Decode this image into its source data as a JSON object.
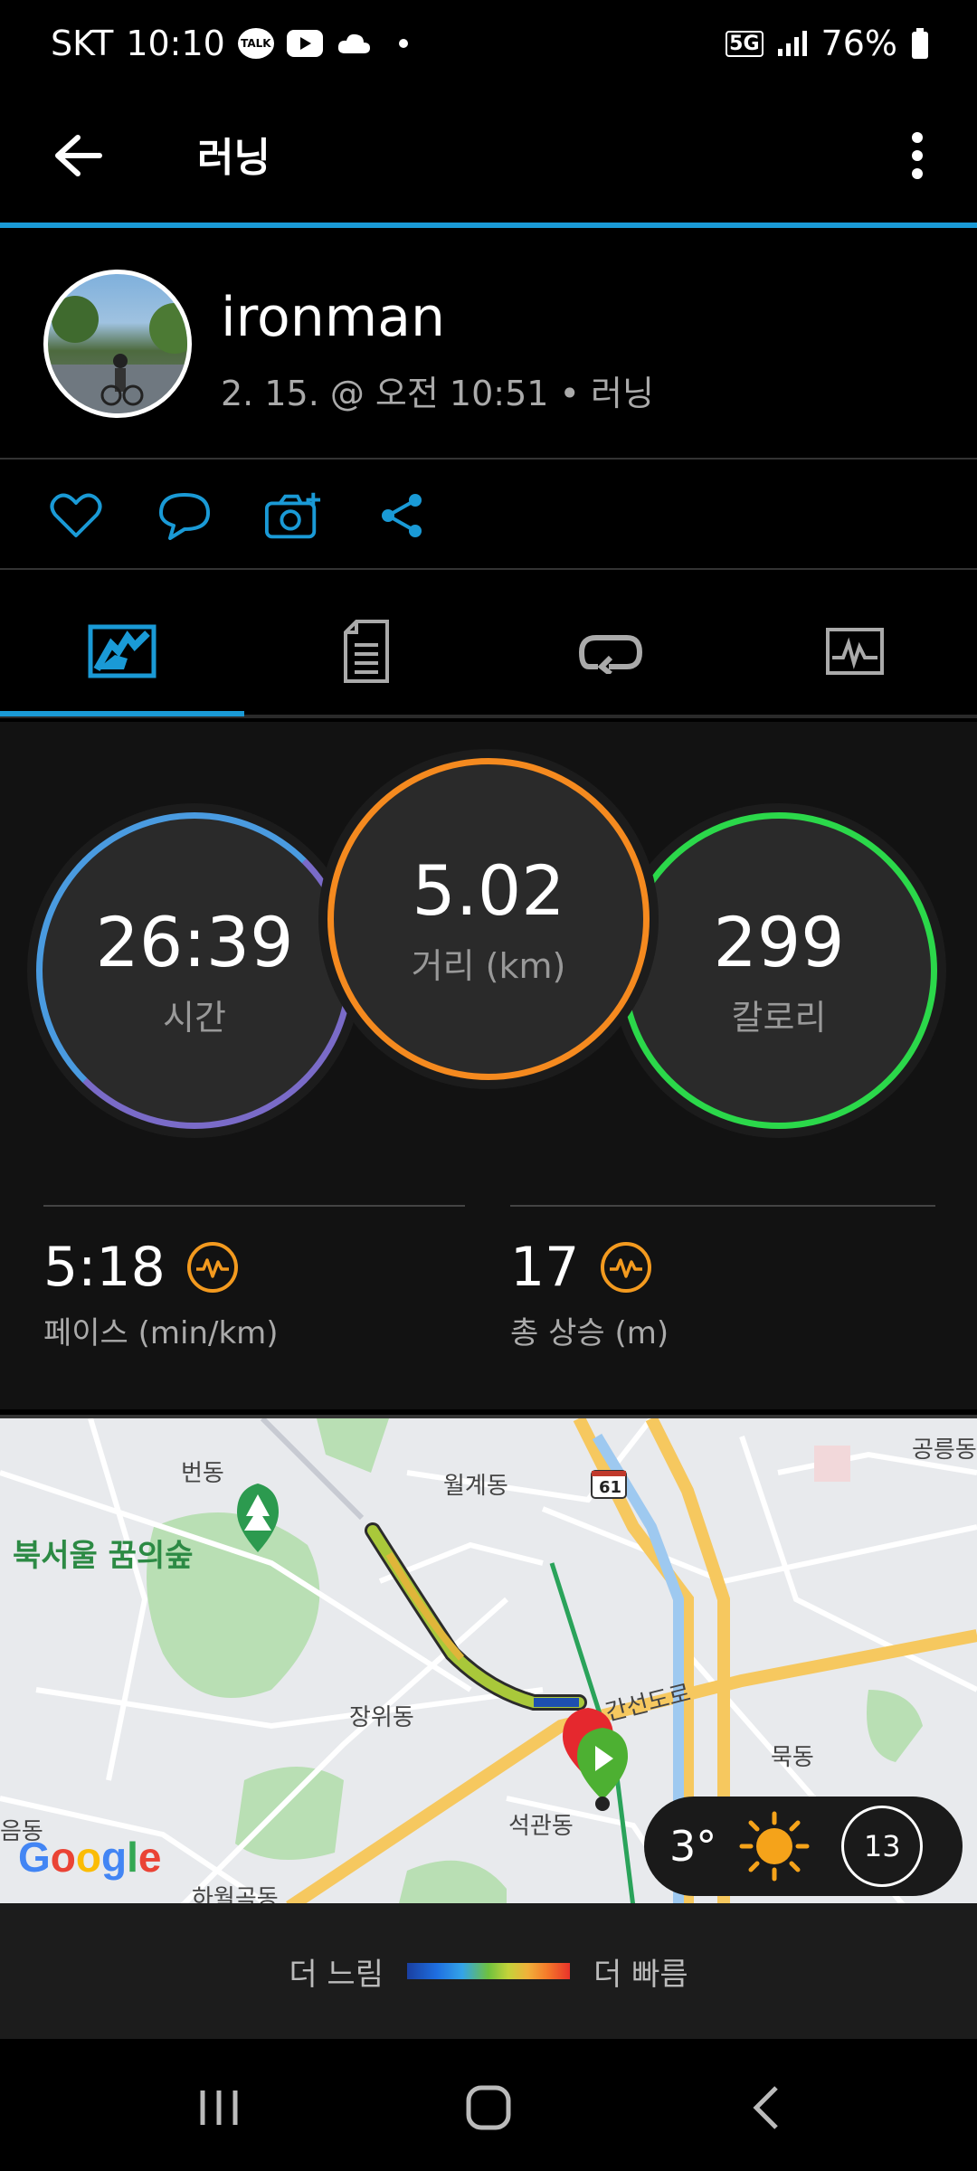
{
  "status_bar": {
    "carrier": "SKT",
    "time": "10:10",
    "network": "5G",
    "battery": "76%"
  },
  "app_bar": {
    "title": "러닝"
  },
  "profile": {
    "username": "ironman",
    "meta": "2. 15. @ 오전 10:51 • 러닝"
  },
  "stats": {
    "time": {
      "value": "26:39",
      "label": "시간"
    },
    "distance": {
      "value": "5.02",
      "label": "거리 (km)"
    },
    "calories": {
      "value": "299",
      "label": "칼로리"
    },
    "pace": {
      "value": "5:18",
      "label": "페이스 (min/km)"
    },
    "elevation": {
      "value": "17",
      "label": "총 상승 (m)"
    }
  },
  "map": {
    "labels": {
      "bundong": "번동",
      "wolgye": "월계동",
      "gongneung": "공릉동",
      "forest": "북서울 꿈의숲",
      "jangwi": "장위동",
      "mukdong": "묵동",
      "seokgwan": "석관동",
      "hawolgok": "하월곡동",
      "eumdong": "음동",
      "road": "간선도로",
      "route_no": "61"
    },
    "weather": {
      "temp": "3°",
      "wind": "13"
    },
    "brand": "Google"
  },
  "legend": {
    "slow": "더 느림",
    "fast": "더 빠름"
  }
}
